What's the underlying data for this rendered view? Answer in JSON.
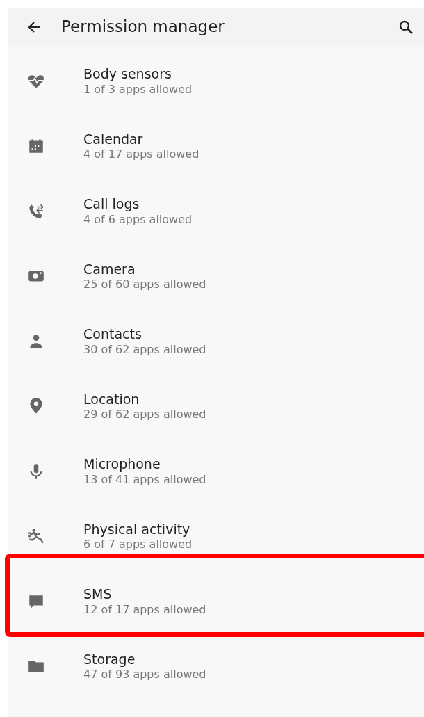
{
  "app_bar": {
    "title": "Permission manager"
  },
  "permissions": [
    {
      "kind": "heart",
      "title": "Body sensors",
      "subtitle": "1 of 3 apps allowed",
      "highlighted": false
    },
    {
      "kind": "calendar",
      "title": "Calendar",
      "subtitle": "4 of 17 apps allowed",
      "highlighted": false
    },
    {
      "kind": "call",
      "title": "Call logs",
      "subtitle": "4 of 6 apps allowed",
      "highlighted": false
    },
    {
      "kind": "camera",
      "title": "Camera",
      "subtitle": "25 of 60 apps allowed",
      "highlighted": false
    },
    {
      "kind": "person",
      "title": "Contacts",
      "subtitle": "30 of 62 apps allowed",
      "highlighted": false
    },
    {
      "kind": "pin",
      "title": "Location",
      "subtitle": "29 of 62 apps allowed",
      "highlighted": false
    },
    {
      "kind": "mic",
      "title": "Microphone",
      "subtitle": "13 of 41 apps allowed",
      "highlighted": false
    },
    {
      "kind": "run",
      "title": "Physical activity",
      "subtitle": "6 of 7 apps allowed",
      "highlighted": false
    },
    {
      "kind": "chat",
      "title": "SMS",
      "subtitle": "12 of 17 apps allowed",
      "highlighted": true
    },
    {
      "kind": "folder",
      "title": "Storage",
      "subtitle": "47 of 93 apps allowed",
      "highlighted": false
    }
  ]
}
